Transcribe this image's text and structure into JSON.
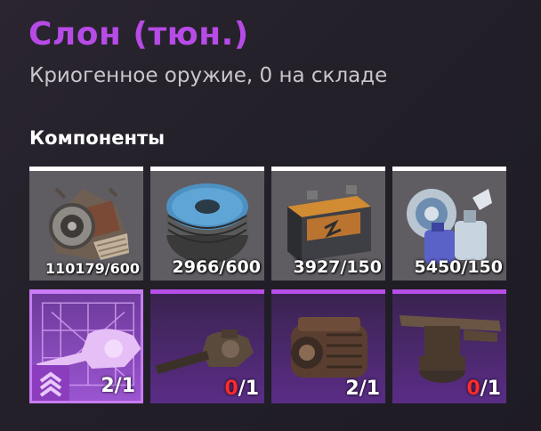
{
  "header": {
    "title": "Слон (тюн.)",
    "subtitle": "Криогенное оружие, 0 на складе"
  },
  "components": {
    "heading": "Компоненты",
    "resources": [
      {
        "icon": "scrap-metal-icon",
        "count": "110179/600"
      },
      {
        "icon": "wire-spool-icon",
        "count": "2966/600"
      },
      {
        "icon": "battery-icon",
        "count": "3927/150"
      },
      {
        "icon": "plastic-parts-icon",
        "count": "5450/150"
      }
    ],
    "parts": [
      {
        "icon": "turret-blueprint-icon",
        "have": "2",
        "sep": "/",
        "need": "1",
        "selected": true
      },
      {
        "icon": "tank-turret-icon",
        "have": "0",
        "sep": "/",
        "need": "1",
        "selected": false
      },
      {
        "icon": "engine-block-icon",
        "have": "2",
        "sep": "/",
        "need": "1",
        "selected": false
      },
      {
        "icon": "weapon-mount-icon",
        "have": "0",
        "sep": "/",
        "need": "1",
        "selected": false
      }
    ]
  },
  "colors": {
    "title": "#b64be6",
    "accent_purple": "#b74ee8",
    "missing_red": "#ff2a2a"
  }
}
